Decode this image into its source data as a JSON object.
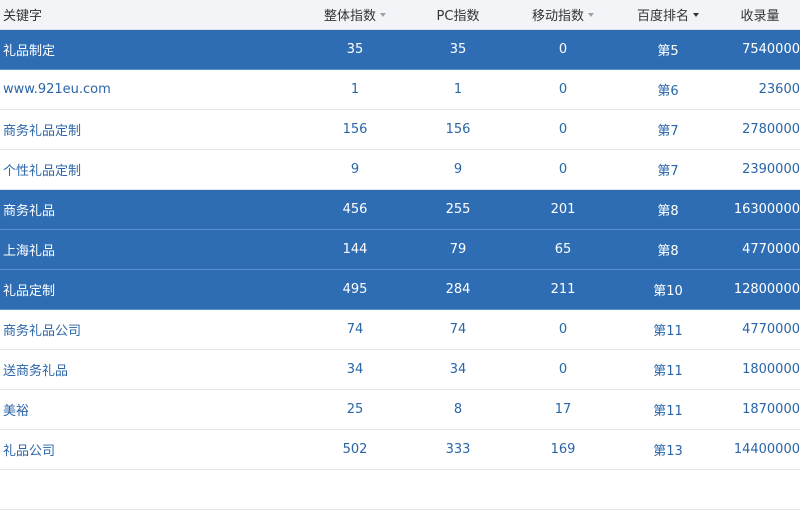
{
  "header": {
    "keyword": "关键字",
    "total_index": "整体指数",
    "pc_index": "PC指数",
    "mobile_index": "移动指数",
    "baidu_rank": "百度排名",
    "indexed": "收录量"
  },
  "rows": [
    {
      "keyword": "礼品制定",
      "total": "35",
      "pc": "35",
      "mobile": "0",
      "rank": "第5",
      "count": "7540000",
      "highlight": true
    },
    {
      "keyword": "www.921eu.com",
      "total": "1",
      "pc": "1",
      "mobile": "0",
      "rank": "第6",
      "count": "23600",
      "highlight": false
    },
    {
      "keyword": "商务礼品定制",
      "total": "156",
      "pc": "156",
      "mobile": "0",
      "rank": "第7",
      "count": "2780000",
      "highlight": false
    },
    {
      "keyword": "个性礼品定制",
      "total": "9",
      "pc": "9",
      "mobile": "0",
      "rank": "第7",
      "count": "2390000",
      "highlight": false
    },
    {
      "keyword": "商务礼品",
      "total": "456",
      "pc": "255",
      "mobile": "201",
      "rank": "第8",
      "count": "16300000",
      "highlight": true
    },
    {
      "keyword": "上海礼品",
      "total": "144",
      "pc": "79",
      "mobile": "65",
      "rank": "第8",
      "count": "4770000",
      "highlight": true
    },
    {
      "keyword": "礼品定制",
      "total": "495",
      "pc": "284",
      "mobile": "211",
      "rank": "第10",
      "count": "12800000",
      "highlight": true
    },
    {
      "keyword": "商务礼品公司",
      "total": "74",
      "pc": "74",
      "mobile": "0",
      "rank": "第11",
      "count": "4770000",
      "highlight": false
    },
    {
      "keyword": "送商务礼品",
      "total": "34",
      "pc": "34",
      "mobile": "0",
      "rank": "第11",
      "count": "1800000",
      "highlight": false
    },
    {
      "keyword": "美裕",
      "total": "25",
      "pc": "8",
      "mobile": "17",
      "rank": "第11",
      "count": "1870000",
      "highlight": false
    },
    {
      "keyword": "礼品公司",
      "total": "502",
      "pc": "333",
      "mobile": "169",
      "rank": "第13",
      "count": "14400000",
      "highlight": false
    }
  ]
}
